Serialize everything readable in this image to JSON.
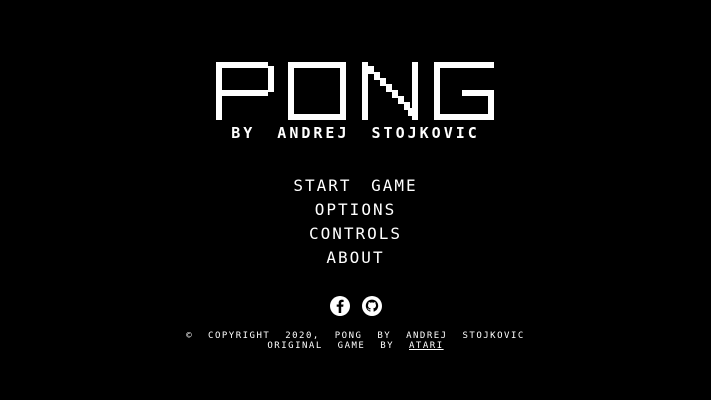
{
  "title": "PONG",
  "subtitle": "BY ANDREJ STOJKOVIC",
  "menu": {
    "items": [
      {
        "label": "START GAME"
      },
      {
        "label": "OPTIONS"
      },
      {
        "label": "CONTROLS"
      },
      {
        "label": "ABOUT"
      }
    ]
  },
  "socials": {
    "facebook_icon": "facebook-icon",
    "github_icon": "github-icon"
  },
  "footer": {
    "copyright": "© COPYRIGHT 2020, PONG BY ANDREJ STOJKOVIC",
    "original_prefix": "ORIGINAL GAME BY ",
    "original_link": "ATARI"
  },
  "colors": {
    "background": "#000000",
    "foreground": "#ffffff"
  }
}
